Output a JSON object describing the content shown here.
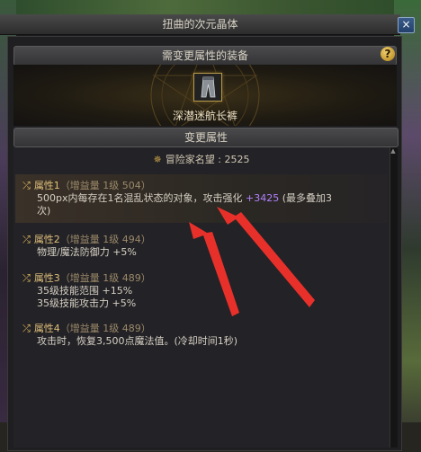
{
  "window": {
    "title": "扭曲的次元晶体",
    "close_symbol": "×"
  },
  "header": {
    "title": "需变更属性的装备",
    "help_symbol": "?"
  },
  "equipment": {
    "name": "深潜迷航长裤"
  },
  "section": {
    "title": "变更属性"
  },
  "reputation": {
    "label": "冒险家名望 : 2525",
    "icon_symbol": "✵"
  },
  "attributes": [
    {
      "name": "属性1",
      "meta": "（增益量 1级 504）",
      "desc_lines": [
        "500px内每存在1名混乱状态的对象，攻击强化",
        "次)"
      ],
      "bonus": "+3425",
      "bonus_suffix": " (最多叠加3"
    },
    {
      "name": "属性2",
      "meta": "（增益量 1级 494）",
      "desc_lines": [
        "物理/魔法防御力 +5%"
      ]
    },
    {
      "name": "属性3",
      "meta": "（增益量 1级 489）",
      "desc_lines": [
        "35级技能范围 +15%",
        "35级技能攻击力 +5%"
      ]
    },
    {
      "name": "属性4",
      "meta": "（增益量 1级 489）",
      "desc_lines": [
        "攻击时，恢复3,500点魔法值。(冷却时间1秒)"
      ]
    }
  ],
  "colors": {
    "accent_gold": "#e0c07a",
    "purple_bonus": "#b380ff",
    "arrow_red": "#e8302a"
  },
  "icons": {
    "attribute": "shuffle-icon",
    "reputation": "reputation-icon",
    "help": "help-icon",
    "close": "close-icon"
  }
}
